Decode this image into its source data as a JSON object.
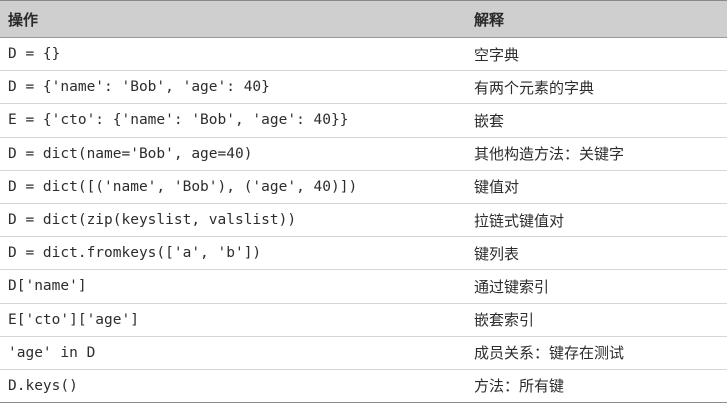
{
  "table": {
    "headers": [
      "操作",
      "解释"
    ],
    "rows": [
      {
        "operation": "D = {}",
        "explanation": "空字典"
      },
      {
        "operation": "D = {'name': 'Bob', 'age': 40}",
        "explanation": "有两个元素的字典"
      },
      {
        "operation": "E = {'cto': {'name': 'Bob', 'age': 40}}",
        "explanation": "嵌套"
      },
      {
        "operation": "D = dict(name='Bob', age=40)",
        "explanation": "其他构造方法：关键字"
      },
      {
        "operation": "D = dict([('name', 'Bob'), ('age', 40)])",
        "explanation": "键值对"
      },
      {
        "operation": "D = dict(zip(keyslist, valslist))",
        "explanation": "拉链式键值对"
      },
      {
        "operation": "D = dict.fromkeys(['a', 'b'])",
        "explanation": "键列表"
      },
      {
        "operation": "D['name']",
        "explanation": "通过键索引"
      },
      {
        "operation": "E['cto']['age']",
        "explanation": "嵌套索引"
      },
      {
        "operation": "'age' in D",
        "explanation": "成员关系：键存在测试"
      },
      {
        "operation": "D.keys()",
        "explanation": "方法：所有键"
      }
    ]
  }
}
